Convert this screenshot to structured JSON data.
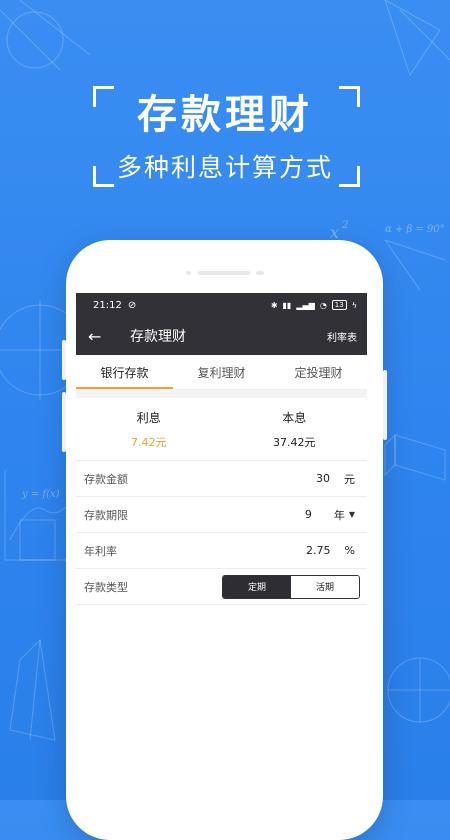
{
  "promo": {
    "headline": "存款理财",
    "subline": "多种利息计算方式"
  },
  "status_bar": {
    "time": "21:12",
    "battery": "13"
  },
  "app_bar": {
    "title": "存款理财",
    "action": "利率表"
  },
  "tabs": [
    {
      "label": "银行存款",
      "active": true
    },
    {
      "label": "复利理财",
      "active": false
    },
    {
      "label": "定投理财",
      "active": false
    }
  ],
  "summary": {
    "interest_label": "利息",
    "interest_value": "7.42元",
    "principal_label": "本息",
    "principal_value": "37.42元"
  },
  "form": {
    "amount": {
      "label": "存款金额",
      "value": "30",
      "unit": "元"
    },
    "period": {
      "label": "存款期限",
      "value": "9",
      "unit": "年"
    },
    "rate": {
      "label": "年利率",
      "value": "2.75",
      "unit": "%"
    },
    "type": {
      "label": "存款类型",
      "options": [
        "定期",
        "活期"
      ],
      "selected": "定期"
    }
  },
  "colors": {
    "background_blue": "#2f84ee",
    "bar_dark": "#323137",
    "accent_orange": "#e9a235"
  },
  "decor_formulas": {
    "x_squared": "x",
    "x_squared_exp": "2",
    "angle_sum": "α + β = 90°",
    "function": "y = f(x)"
  }
}
